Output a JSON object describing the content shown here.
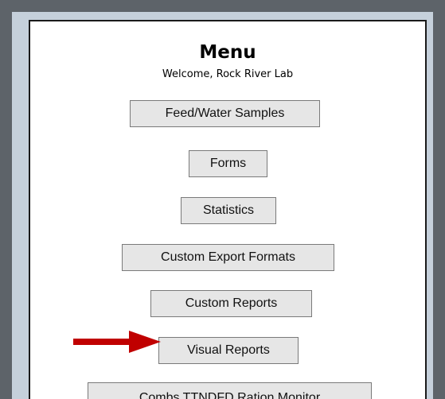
{
  "menu": {
    "title": "Menu",
    "welcome": "Welcome, Rock River Lab",
    "buttons": [
      {
        "label": "Feed/Water Samples"
      },
      {
        "label": "Forms"
      },
      {
        "label": "Statistics"
      },
      {
        "label": "Custom Export Formats"
      },
      {
        "label": "Custom Reports"
      },
      {
        "label": "Visual Reports"
      },
      {
        "label": "Combs TTNDFD Ration Monitor"
      }
    ]
  },
  "annotation": {
    "arrow_icon": "red-arrow-right-icon",
    "arrow_color": "#c00000"
  },
  "colors": {
    "background": "#5d6369",
    "panel": "#c5d0db",
    "button_face": "#e6e6e6"
  }
}
